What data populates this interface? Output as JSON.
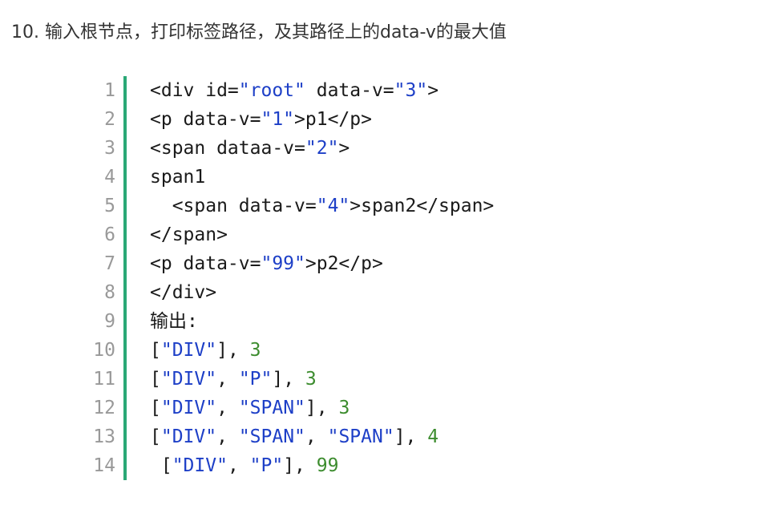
{
  "heading": "10. 输入根节点，打印标签路径，及其路径上的data-v的最大值",
  "colors": {
    "string": "#1d3fc7",
    "number": "#3c8c2e",
    "border": "#2aa876",
    "line_number": "#999999"
  },
  "code": {
    "line_numbers": [
      "1",
      "2",
      "3",
      "4",
      "5",
      "6",
      "7",
      "8",
      "9",
      "10",
      "11",
      "12",
      "13",
      "14"
    ],
    "lines": [
      [
        {
          "t": "plain",
          "v": "<div id="
        },
        {
          "t": "str",
          "v": "\"root\""
        },
        {
          "t": "plain",
          "v": " data-v="
        },
        {
          "t": "str",
          "v": "\"3\""
        },
        {
          "t": "plain",
          "v": ">"
        }
      ],
      [
        {
          "t": "plain",
          "v": "<p data-v="
        },
        {
          "t": "str",
          "v": "\"1\""
        },
        {
          "t": "plain",
          "v": ">p1</p>"
        }
      ],
      [
        {
          "t": "plain",
          "v": "<span dataa-v="
        },
        {
          "t": "str",
          "v": "\"2\""
        },
        {
          "t": "plain",
          "v": ">"
        }
      ],
      [
        {
          "t": "plain",
          "v": "span1"
        }
      ],
      [
        {
          "t": "plain",
          "v": "  <span data-v="
        },
        {
          "t": "str",
          "v": "\"4\""
        },
        {
          "t": "plain",
          "v": ">span2</span>"
        }
      ],
      [
        {
          "t": "plain",
          "v": "</span>"
        }
      ],
      [
        {
          "t": "plain",
          "v": "<p data-v="
        },
        {
          "t": "str",
          "v": "\"99\""
        },
        {
          "t": "plain",
          "v": ">p2</p>"
        }
      ],
      [
        {
          "t": "plain",
          "v": "</div>"
        }
      ],
      [
        {
          "t": "plain",
          "v": "输出:"
        }
      ],
      [
        {
          "t": "plain",
          "v": "["
        },
        {
          "t": "str",
          "v": "\"DIV\""
        },
        {
          "t": "plain",
          "v": "], "
        },
        {
          "t": "num",
          "v": "3"
        }
      ],
      [
        {
          "t": "plain",
          "v": "["
        },
        {
          "t": "str",
          "v": "\"DIV\""
        },
        {
          "t": "plain",
          "v": ", "
        },
        {
          "t": "str",
          "v": "\"P\""
        },
        {
          "t": "plain",
          "v": "], "
        },
        {
          "t": "num",
          "v": "3"
        }
      ],
      [
        {
          "t": "plain",
          "v": "["
        },
        {
          "t": "str",
          "v": "\"DIV\""
        },
        {
          "t": "plain",
          "v": ", "
        },
        {
          "t": "str",
          "v": "\"SPAN\""
        },
        {
          "t": "plain",
          "v": "], "
        },
        {
          "t": "num",
          "v": "3"
        }
      ],
      [
        {
          "t": "plain",
          "v": "["
        },
        {
          "t": "str",
          "v": "\"DIV\""
        },
        {
          "t": "plain",
          "v": ", "
        },
        {
          "t": "str",
          "v": "\"SPAN\""
        },
        {
          "t": "plain",
          "v": ", "
        },
        {
          "t": "str",
          "v": "\"SPAN\""
        },
        {
          "t": "plain",
          "v": "], "
        },
        {
          "t": "num",
          "v": "4"
        }
      ],
      [
        {
          "t": "plain",
          "v": " ["
        },
        {
          "t": "str",
          "v": "\"DIV\""
        },
        {
          "t": "plain",
          "v": ", "
        },
        {
          "t": "str",
          "v": "\"P\""
        },
        {
          "t": "plain",
          "v": "], "
        },
        {
          "t": "num",
          "v": "99"
        }
      ]
    ]
  }
}
